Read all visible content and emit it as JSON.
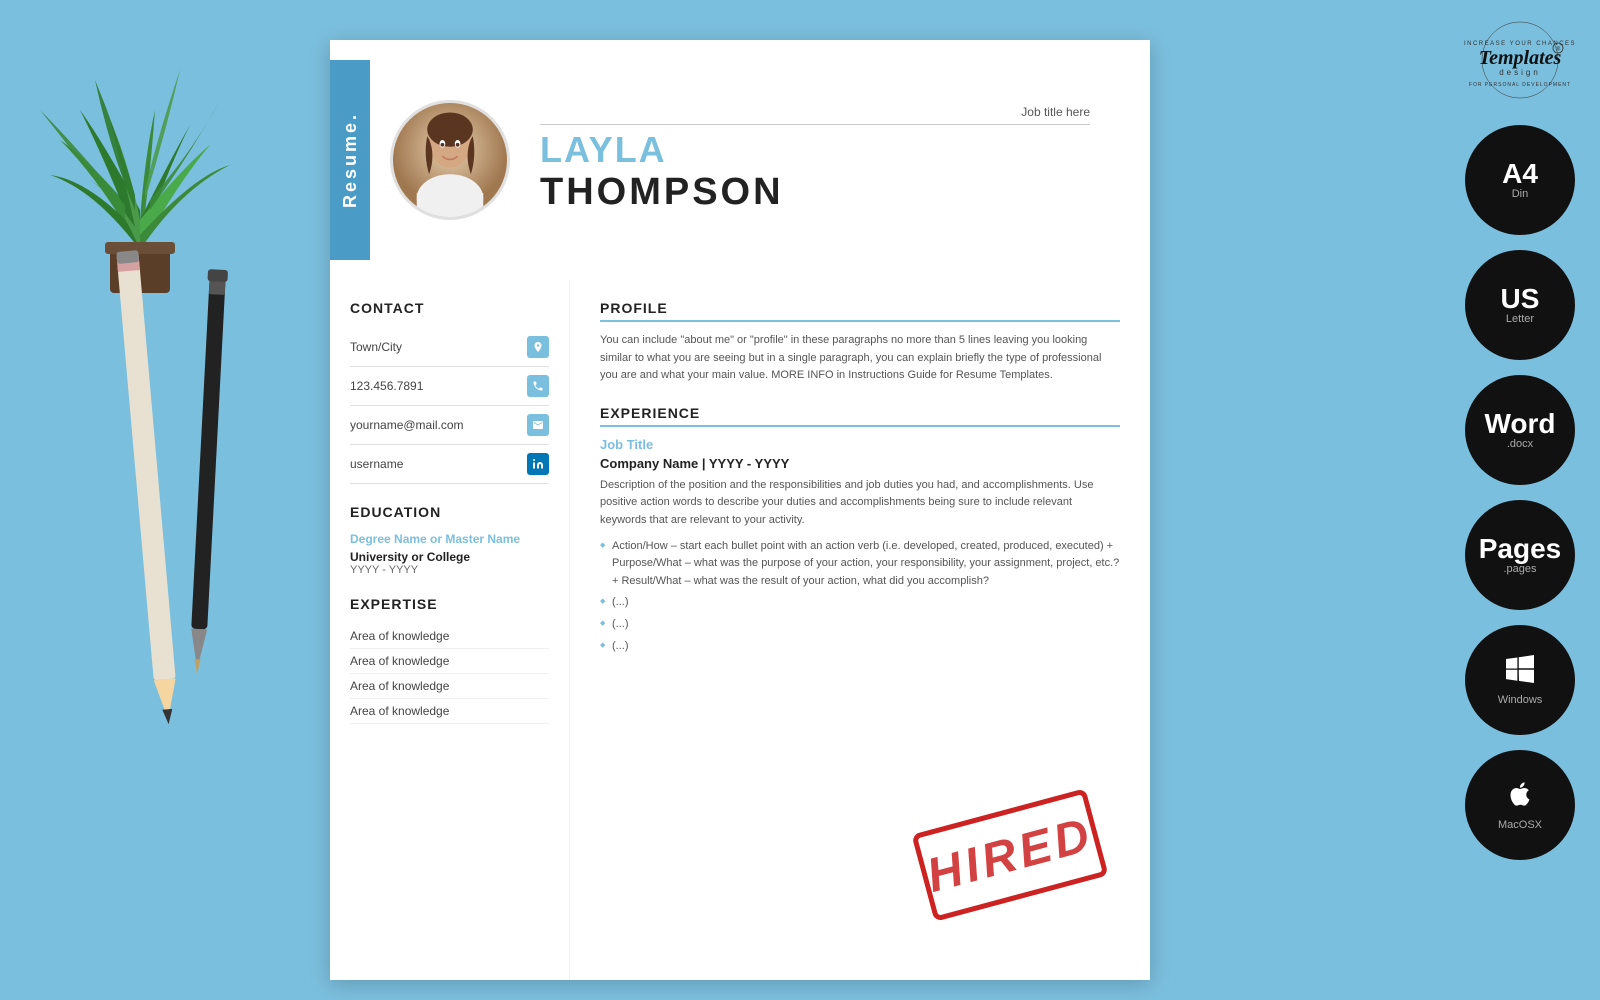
{
  "background_color": "#7bbfde",
  "brand": {
    "name": "Templates",
    "sub": "design",
    "tagline_top": "INCREASE YOUR CHANCES",
    "tagline_bottom": "FOR PERSONAL DEVELOPMENT"
  },
  "resume": {
    "label": "Resume.",
    "job_title_placeholder": "Job title here",
    "first_name": "LAYLA",
    "last_name": "THOMPSON",
    "contact": {
      "section_title": "CONTACT",
      "items": [
        {
          "label": "Town/City",
          "type": "location"
        },
        {
          "label": "123.456.7891",
          "type": "phone"
        },
        {
          "label": "yourname@mail.com",
          "type": "email"
        },
        {
          "label": "username",
          "type": "linkedin"
        }
      ]
    },
    "education": {
      "section_title": "EDUCATION",
      "degree": "Degree Name or Master Name",
      "university": "University or College",
      "years": "YYYY - YYYY"
    },
    "expertise": {
      "section_title": "EXPERTISE",
      "items": [
        "Area of knowledge",
        "Area of knowledge",
        "Area of knowledge",
        "Area of knowledge"
      ]
    },
    "profile": {
      "section_title": "PROFILE",
      "text": "You can include \"about me\" or \"profile\" in these paragraphs no more than 5 lines leaving you looking similar to what you are seeing but in a single paragraph, you can explain briefly the type of professional you are and what your main value. MORE INFO in Instructions Guide for Resume Templates."
    },
    "experience": {
      "section_title": "EXPERIENCE",
      "job_title": "Job Title",
      "company": "Company Name | YYYY - YYYY",
      "description": "Description of the position and the responsibilities and job duties you had, and accomplishments. Use positive action words to describe your duties and accomplishments being sure to include relevant keywords that are relevant to your activity.",
      "bullets": [
        "Action/How – start each bullet point with an action verb (i.e. developed, created, produced, executed) + Purpose/What – what was the purpose of your action, your responsibility, your assignment, project, etc.? + Result/What – what was the result of your action, what did you accomplish?",
        "(...)",
        "(...)",
        "(...)"
      ]
    }
  },
  "format_badges": [
    {
      "main": "A4",
      "sub": "Din"
    },
    {
      "main": "US",
      "sub": "Letter"
    },
    {
      "main": "Word",
      "sub": ".docx"
    },
    {
      "main": "Pages",
      "sub": ".pages"
    },
    {
      "main": "Windows",
      "sub": "",
      "type": "windows"
    },
    {
      "main": "MacOSX",
      "sub": "",
      "type": "mac"
    }
  ],
  "hired_stamp": "HIRED"
}
